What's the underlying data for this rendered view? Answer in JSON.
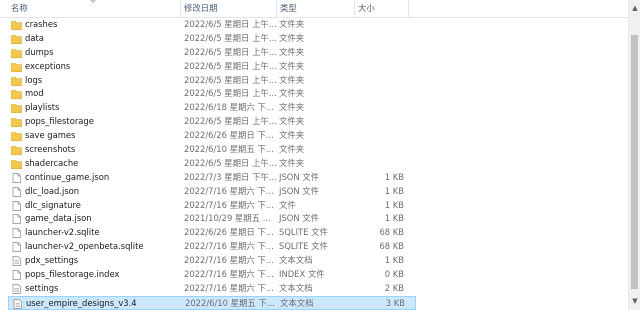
{
  "header": {
    "name": "名称",
    "date": "修改日期",
    "type": "类型",
    "size": "大小"
  },
  "files": [
    {
      "icon": "folder-icon",
      "name": "crashes",
      "date": "2022/6/5 星期日 上午...",
      "type": "文件夹",
      "size": ""
    },
    {
      "icon": "folder-icon",
      "name": "data",
      "date": "2022/6/5 星期日 上午...",
      "type": "文件夹",
      "size": ""
    },
    {
      "icon": "folder-icon",
      "name": "dumps",
      "date": "2022/6/5 星期日 上午...",
      "type": "文件夹",
      "size": ""
    },
    {
      "icon": "folder-icon",
      "name": "exceptions",
      "date": "2022/6/5 星期日 上午...",
      "type": "文件夹",
      "size": ""
    },
    {
      "icon": "folder-icon",
      "name": "logs",
      "date": "2022/6/5 星期日 上午...",
      "type": "文件夹",
      "size": ""
    },
    {
      "icon": "folder-icon",
      "name": "mod",
      "date": "2022/6/5 星期日 上午...",
      "type": "文件夹",
      "size": ""
    },
    {
      "icon": "folder-icon",
      "name": "playlists",
      "date": "2022/6/18 星期六 下...",
      "type": "文件夹",
      "size": ""
    },
    {
      "icon": "folder-icon",
      "name": "pops_filestorage",
      "date": "2022/6/5 星期日 上午...",
      "type": "文件夹",
      "size": ""
    },
    {
      "icon": "folder-icon",
      "name": "save games",
      "date": "2022/6/26 星期日 下...",
      "type": "文件夹",
      "size": ""
    },
    {
      "icon": "folder-icon",
      "name": "screenshots",
      "date": "2022/6/10 星期五 下...",
      "type": "文件夹",
      "size": ""
    },
    {
      "icon": "folder-icon",
      "name": "shadercache",
      "date": "2022/6/5 星期日 上午...",
      "type": "文件夹",
      "size": ""
    },
    {
      "icon": "file-icon",
      "name": "continue_game.json",
      "date": "2022/7/3 星期日 下午...",
      "type": "JSON 文件",
      "size": "1 KB"
    },
    {
      "icon": "file-icon",
      "name": "dlc_load.json",
      "date": "2022/7/16 星期六 下...",
      "type": "JSON 文件",
      "size": "1 KB"
    },
    {
      "icon": "file-icon",
      "name": "dlc_signature",
      "date": "2022/7/16 星期六 下...",
      "type": "文件",
      "size": "1 KB"
    },
    {
      "icon": "file-icon",
      "name": "game_data.json",
      "date": "2021/10/29 星期五 ...",
      "type": "JSON 文件",
      "size": "1 KB"
    },
    {
      "icon": "file-icon",
      "name": "launcher-v2.sqlite",
      "date": "2022/6/26 星期日 下...",
      "type": "SQLITE 文件",
      "size": "68 KB"
    },
    {
      "icon": "file-icon",
      "name": "launcher-v2_openbeta.sqlite",
      "date": "2022/7/16 星期六 下...",
      "type": "SQLITE 文件",
      "size": "68 KB"
    },
    {
      "icon": "text-file-icon",
      "name": "pdx_settings",
      "date": "2022/7/16 星期六 下...",
      "type": "文本文档",
      "size": "1 KB"
    },
    {
      "icon": "file-icon",
      "name": "pops_filestorage.index",
      "date": "2022/7/16 星期六 下...",
      "type": "INDEX 文件",
      "size": "0 KB"
    },
    {
      "icon": "text-file-icon",
      "name": "settings",
      "date": "2022/7/16 星期六 下...",
      "type": "文本文档",
      "size": "2 KB"
    },
    {
      "icon": "text-file-icon",
      "name": "user_empire_designs_v3.4",
      "date": "2022/6/10 星期五 下...",
      "type": "文本文档",
      "size": "3 KB",
      "selected": true
    }
  ],
  "colors": {
    "folder": "#f2c94c",
    "selection": "#cce8ff",
    "selection_border": "#99d1ff",
    "header_text": "#4c607a"
  }
}
